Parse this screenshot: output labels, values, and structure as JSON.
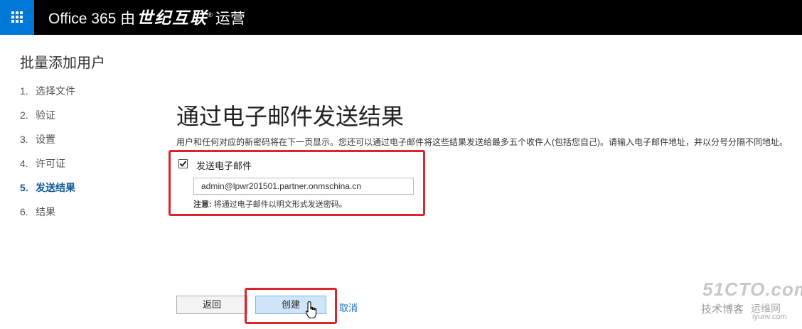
{
  "header": {
    "brand_prefix": "Office 365 由",
    "brand_name": "世纪互联",
    "brand_reg": "®",
    "brand_suffix": "运营"
  },
  "page_title": "批量添加用户",
  "steps": [
    {
      "num": "1.",
      "label": "选择文件"
    },
    {
      "num": "2.",
      "label": "验证"
    },
    {
      "num": "3.",
      "label": "设置"
    },
    {
      "num": "4.",
      "label": "许可证"
    },
    {
      "num": "5.",
      "label": "发送结果"
    },
    {
      "num": "6.",
      "label": "结果"
    }
  ],
  "main": {
    "heading": "通过电子邮件发送结果",
    "description": "用户和任何对应的新密码将在下一页显示。您还可以通过电子邮件将这些结果发送给最多五个收件人(包括您自己)。请输入电子邮件地址，并以分号分隔不同地址。",
    "send_email_label": "发送电子邮件",
    "send_email_checked": true,
    "email_value": "admin@lpwr201501.partner.onmschina.cn",
    "note_prefix": "注意:",
    "note_text": " 将通过电子邮件以明文形式发送密码。"
  },
  "buttons": {
    "back": "返回",
    "create": "创建",
    "cancel": "取消"
  },
  "watermark": {
    "line1": "51CTO.com",
    "line2": "技术博客",
    "line3": "运维网",
    "line4": "iyunv.com"
  },
  "colors": {
    "topbar": "#000000",
    "waffle": "#0078d7",
    "active_step": "#0f5a9a",
    "highlight": "#d9252b",
    "link": "#1a6cb8"
  }
}
